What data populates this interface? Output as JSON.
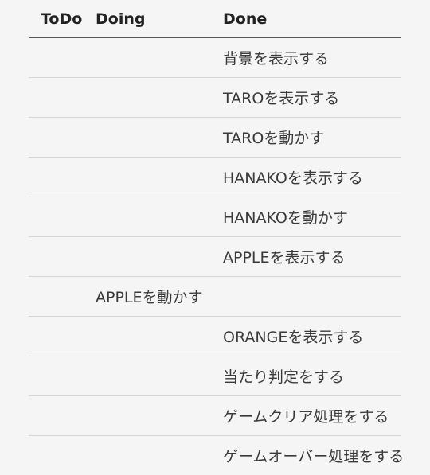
{
  "columns": {
    "todo": "ToDo",
    "doing": "Doing",
    "done": "Done"
  },
  "rows": [
    {
      "todo": "",
      "doing": "",
      "done": "背景を表示する"
    },
    {
      "todo": "",
      "doing": "",
      "done": "TAROを表示する"
    },
    {
      "todo": "",
      "doing": "",
      "done": "TAROを動かす"
    },
    {
      "todo": "",
      "doing": "",
      "done": "HANAKOを表示する"
    },
    {
      "todo": "",
      "doing": "",
      "done": "HANAKOを動かす"
    },
    {
      "todo": "",
      "doing": "",
      "done": "APPLEを表示する"
    },
    {
      "todo": "",
      "doing": "APPLEを動かす",
      "done": ""
    },
    {
      "todo": "",
      "doing": "",
      "done": "ORANGEを表示する"
    },
    {
      "todo": "",
      "doing": "",
      "done": "当たり判定をする"
    },
    {
      "todo": "",
      "doing": "",
      "done": "ゲームクリア処理をする"
    },
    {
      "todo": "",
      "doing": "",
      "done": "ゲームオーバー処理をする"
    }
  ]
}
